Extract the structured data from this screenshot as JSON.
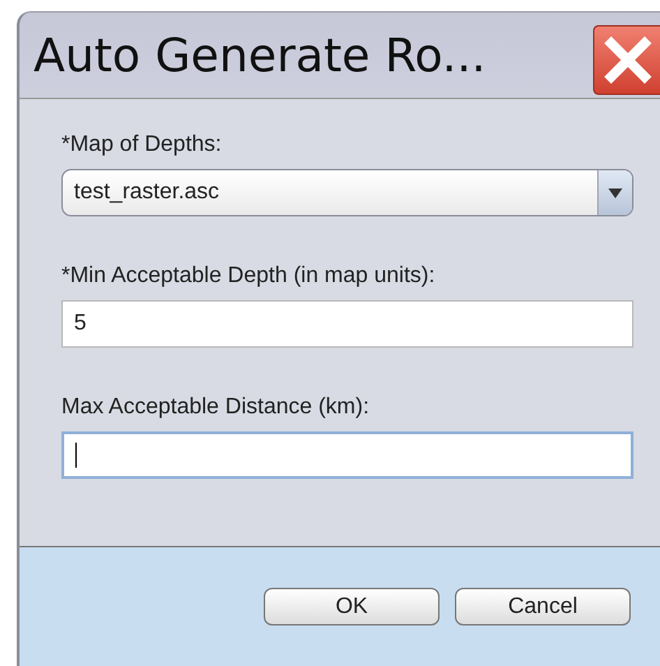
{
  "window": {
    "title": "Auto Generate Ro..."
  },
  "fields": [
    {
      "kind": "dropdown",
      "label": "*Map of Depths:",
      "value": "test_raster.asc"
    },
    {
      "kind": "text",
      "label": "*Min Acceptable Depth (in map units):",
      "value": "5"
    },
    {
      "kind": "text",
      "label": "Max Acceptable Distance (km):",
      "focused": true
    }
  ],
  "buttons": [
    "OK",
    "Cancel"
  ]
}
